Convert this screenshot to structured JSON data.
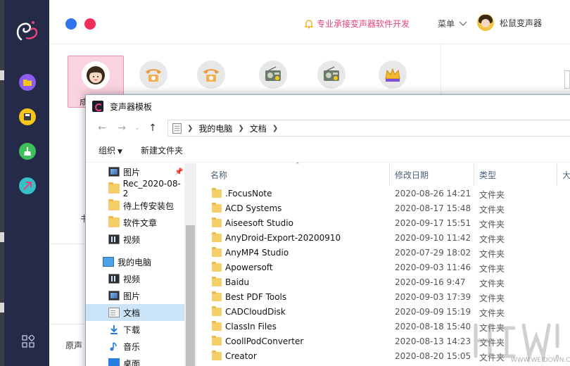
{
  "app": {
    "promo_text": "专业承接变声器软件开发",
    "menu_label": "菜单",
    "user_name": "松鼠变声器",
    "partial_label_1": "成",
    "partial_label_2": "书",
    "footer_label": "原声",
    "colors": {
      "sidebar": "#252a48",
      "accent_pink": "#e8437b",
      "traffic_blue": "#2f73f0",
      "traffic_red": "#f0305a",
      "btn_folder": "#8e5cf0",
      "btn_save": "#f5c518",
      "btn_clean": "#3fbf5a",
      "btn_share": "#36c0c8"
    },
    "sidebar_icons": [
      "folder-icon",
      "save-icon",
      "broom-icon",
      "share-icon",
      "grid-icon"
    ],
    "presets": [
      {
        "icon": "girl-face-icon",
        "selected": true
      },
      {
        "icon": "telephone-icon",
        "selected": false
      },
      {
        "icon": "telephone-icon",
        "selected": false
      },
      {
        "icon": "radio-icon",
        "selected": false
      },
      {
        "icon": "radio-icon",
        "selected": false
      },
      {
        "icon": "crown-icon",
        "selected": false
      }
    ]
  },
  "dialog": {
    "title": "变声器模板",
    "breadcrumb": [
      "我的电脑",
      "文档"
    ],
    "toolbar": {
      "organize": "组织",
      "new_folder": "新建文件夹"
    },
    "nav": [
      {
        "label": "图片",
        "icon": "picture-icon",
        "pinned": true,
        "selected": false
      },
      {
        "label": "Rec_2020-08-2",
        "icon": "folder-icon",
        "pinned": false,
        "selected": false
      },
      {
        "label": "待上传安装包",
        "icon": "folder-icon",
        "pinned": false,
        "selected": false
      },
      {
        "label": "软件文章",
        "icon": "folder-icon",
        "pinned": false,
        "selected": false
      },
      {
        "label": "视频",
        "icon": "video-icon",
        "pinned": false,
        "selected": false
      },
      {
        "label": "我的电脑",
        "icon": "computer-icon",
        "pinned": false,
        "selected": false
      },
      {
        "label": "视频",
        "icon": "video-icon",
        "pinned": false,
        "selected": false
      },
      {
        "label": "图片",
        "icon": "picture-icon",
        "pinned": false,
        "selected": false
      },
      {
        "label": "文档",
        "icon": "document-icon",
        "pinned": false,
        "selected": true
      },
      {
        "label": "下载",
        "icon": "download-icon",
        "pinned": false,
        "selected": false
      },
      {
        "label": "音乐",
        "icon": "music-icon",
        "pinned": false,
        "selected": false
      },
      {
        "label": "桌面",
        "icon": "desktop-icon",
        "pinned": false,
        "selected": false
      }
    ],
    "columns": {
      "name": "名称",
      "date": "修改日期",
      "type": "类型",
      "size": "大"
    },
    "files": [
      {
        "name": ".FocusNote",
        "date": "2020-08-26 14:21",
        "type": "文件夹"
      },
      {
        "name": "ACD Systems",
        "date": "2020-08-17 15:48",
        "type": "文件夹"
      },
      {
        "name": "Aiseesoft Studio",
        "date": "2020-09-17 15:51",
        "type": "文件夹"
      },
      {
        "name": "AnyDroid-Export-20200910",
        "date": "2020-09-10 11:42",
        "type": "文件夹"
      },
      {
        "name": "AnyMP4 Studio",
        "date": "2020-07-29 18:02",
        "type": "文件夹"
      },
      {
        "name": "Apowersoft",
        "date": "2020-09-03 11:46",
        "type": "文件夹"
      },
      {
        "name": "Baidu",
        "date": "2020-09-16 9:47",
        "type": "文件夹"
      },
      {
        "name": "Best PDF Tools",
        "date": "2020-09-03 17:39",
        "type": "文件夹"
      },
      {
        "name": "CADCloudDisk",
        "date": "2020-09-09 15:19",
        "type": "文件夹"
      },
      {
        "name": "ClassIn Files",
        "date": "2020-08-18 15:40",
        "type": "文件夹"
      },
      {
        "name": "CoollPodConverter",
        "date": "2020-08-13 14:23",
        "type": "文件夹"
      },
      {
        "name": "Creator",
        "date": "2020-08-20 15:05",
        "type": "文件夹"
      }
    ]
  },
  "watermark": "WWW.WEIDOWN.COM"
}
